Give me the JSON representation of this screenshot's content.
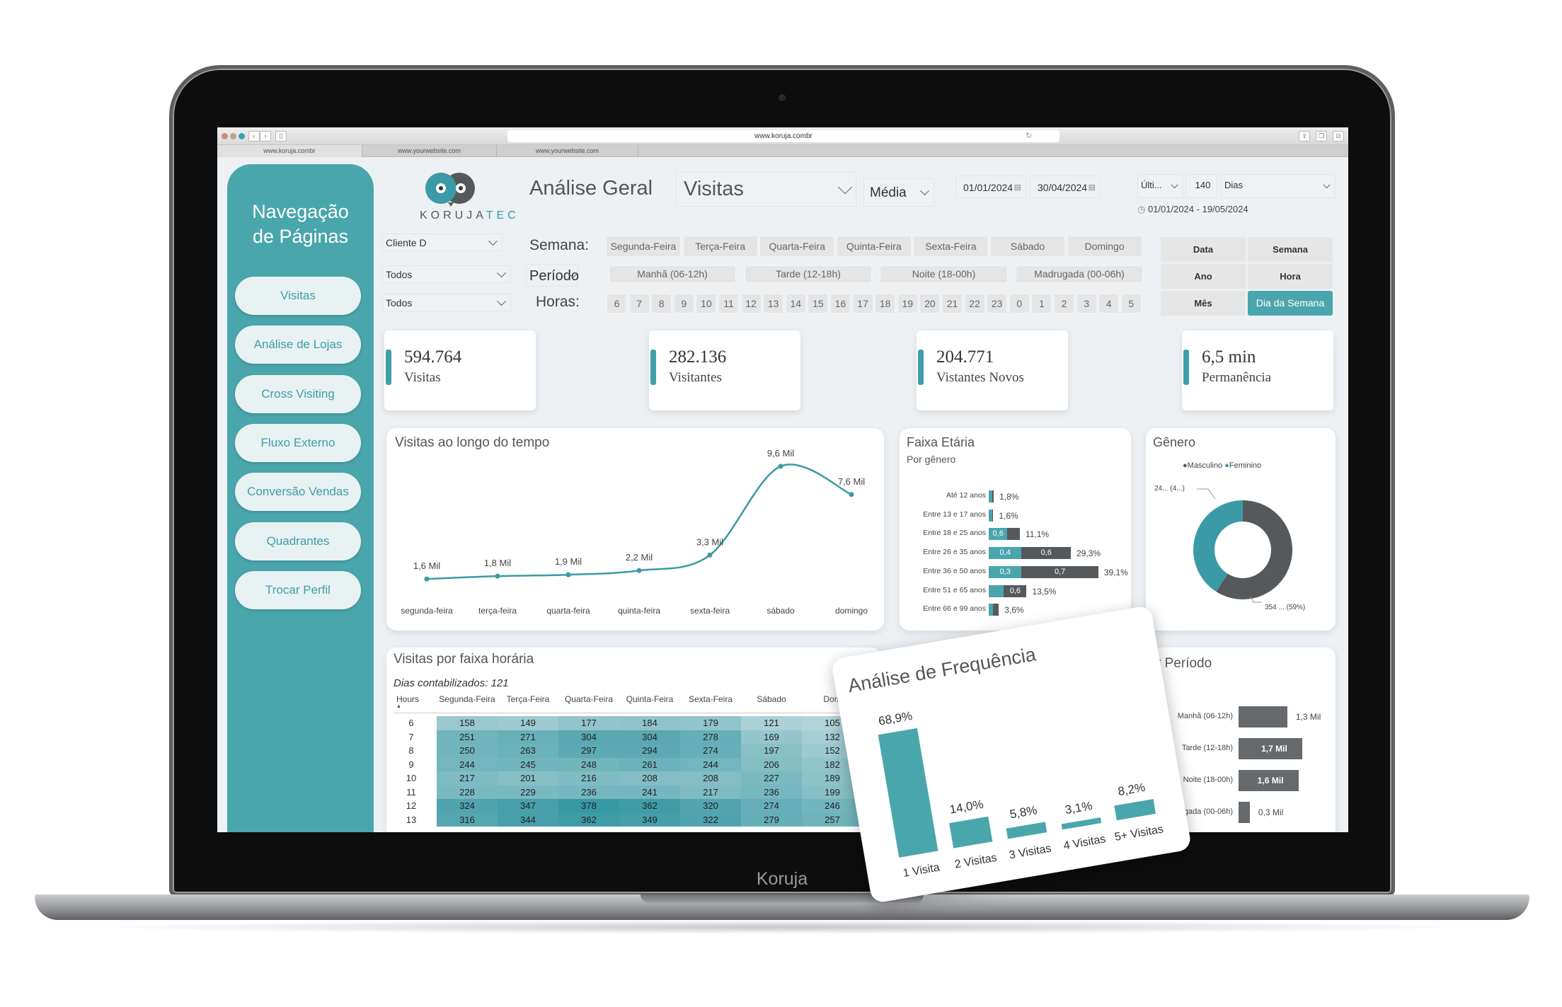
{
  "colors": {
    "teal": "#4aa6ad",
    "teal_dark": "#3a9aa5",
    "gray_dark": "#55595c",
    "dashboard_bg": "#edf1f4"
  },
  "laptop": {
    "brand": "Koruja"
  },
  "browser": {
    "url": "www.koruja.combr",
    "tabs": [
      "www.koruja.combr",
      "www.yourwebsite.com",
      "www.yourwebsite.com"
    ],
    "close": "x"
  },
  "sidebar": {
    "title_line1": "Navegação",
    "title_line2": "de Páginas",
    "items": [
      "Visitas",
      "Análise de Lojas",
      "Cross Visiting",
      "Fluxo Externo",
      "Conversão Vendas",
      "Quadrantes",
      "Trocar Perfil"
    ]
  },
  "logo": {
    "text_a": "KORUJA",
    "text_b": "TEC"
  },
  "filters": {
    "client": "Cliente D",
    "filter2": "Todos",
    "filter3": "Todos"
  },
  "header": {
    "title": "Análise Geral",
    "metric": "Visitas",
    "aggregation": "Média",
    "date_start": "01/01/2024",
    "date_end": "30/04/2024",
    "relative_mode": "Últi...",
    "relative_count": "140",
    "relative_unit": "Dias",
    "date_range": "01/01/2024 - 19/05/2024"
  },
  "semana": {
    "label": "Semana:",
    "days": [
      "Segunda-Feira",
      "Terça-Feira",
      "Quarta-Feira",
      "Quinta-Feira",
      "Sexta-Feira",
      "Sábado",
      "Domingo"
    ]
  },
  "periodo": {
    "label": "Período",
    "options": [
      "Manhã (06-12h)",
      "Tarde (12-18h)",
      "Noite (18-00h)",
      "Madrugada (00-06h)"
    ]
  },
  "horas": {
    "label": "Horas:",
    "values": [
      "6",
      "7",
      "8",
      "9",
      "10",
      "11",
      "12",
      "13",
      "14",
      "15",
      "16",
      "17",
      "18",
      "19",
      "20",
      "21",
      "22",
      "23",
      "0",
      "1",
      "2",
      "3",
      "4",
      "5"
    ]
  },
  "granularity": {
    "options": [
      "Data",
      "Semana",
      "Ano",
      "Hora",
      "Mês",
      "Dia da Semana"
    ],
    "active": "Dia da Semana"
  },
  "kpis": [
    {
      "value": "594.764",
      "label": "Visitas"
    },
    {
      "value": "282.136",
      "label": "Visitantes"
    },
    {
      "value": "204.771",
      "label": "Vistantes Novos"
    },
    {
      "value": "6,5 min",
      "label": "Permanência"
    }
  ],
  "chart_data": [
    {
      "type": "line",
      "title": "Visitas ao longo do tempo",
      "categories": [
        "segunda-feira",
        "terça-feira",
        "quarta-feira",
        "quinta-feira",
        "sexta-feira",
        "sábado",
        "domingo"
      ],
      "values": [
        1.6,
        1.8,
        1.9,
        2.2,
        3.3,
        9.6,
        7.6
      ],
      "data_labels": [
        "1,6 Mil",
        "1,8 Mil",
        "1,9 Mil",
        "2,2 Mil",
        "3,3 Mil",
        "9,6 Mil",
        "7,6 Mil"
      ],
      "unit": "Mil",
      "grid": false
    },
    {
      "type": "bar",
      "orientation": "horizontal",
      "stacked": true,
      "title": "Faixa Etária",
      "subtitle": "Por gênero",
      "categories": [
        "Até 12 anos",
        "Entre 13 e 17 anos",
        "Entre 18 e 25 anos",
        "Entre 26 e 35 anos",
        "Entre 36 e 50 anos",
        "Entre 51 e 65 anos",
        "Entre 66 e 99 anos"
      ],
      "totals": [
        1.8,
        1.6,
        11.1,
        29.3,
        39.1,
        13.5,
        3.6
      ],
      "total_labels": [
        "1,8%",
        "1,6%",
        "11,1%",
        "29,3%",
        "39,1%",
        "13,5%",
        "3,6%"
      ],
      "feminino_share": [
        0.7,
        0.8,
        0.6,
        0.4,
        0.3,
        0.4,
        0.4
      ],
      "feminino_labels": [
        "",
        "",
        "0,6",
        "0,4",
        "0,3",
        "",
        ""
      ],
      "masculino_labels": [
        "",
        "",
        "",
        "0,6",
        "0,7",
        "0,6",
        ""
      ]
    },
    {
      "type": "pie",
      "donut": true,
      "title": "Gênero",
      "legend": [
        "Masculino",
        "Feminino"
      ],
      "legend_position": "top",
      "values": [
        59,
        41
      ],
      "labels": [
        "354 ... (59%)",
        "24... (4...)"
      ]
    },
    {
      "type": "heatmap",
      "title": "Visitas por faixa horária",
      "subtitle": "Dias contabilizados: 121",
      "row_header": "Hours",
      "columns": [
        "Segunda-Feira",
        "Terça-Feira",
        "Quarta-Feira",
        "Quinta-Feira",
        "Sexta-Feira",
        "Sábado",
        "Dom"
      ],
      "rows": [
        "6",
        "7",
        "8",
        "9",
        "10",
        "11",
        "12",
        "13"
      ],
      "values": [
        [
          158,
          149,
          177,
          184,
          179,
          121,
          105
        ],
        [
          251,
          271,
          304,
          304,
          278,
          169,
          132
        ],
        [
          250,
          263,
          297,
          294,
          274,
          197,
          152
        ],
        [
          244,
          245,
          248,
          261,
          244,
          206,
          182
        ],
        [
          217,
          201,
          216,
          208,
          208,
          227,
          189
        ],
        [
          228,
          229,
          236,
          241,
          217,
          236,
          199
        ],
        [
          324,
          347,
          378,
          362,
          320,
          274,
          246
        ],
        [
          316,
          344,
          362,
          349,
          322,
          279,
          257
        ]
      ]
    },
    {
      "type": "bar",
      "orientation": "horizontal",
      "title": "Visitas por Período",
      "categories": [
        "Manhã (06-12h)",
        "Tarde (12-18h)",
        "Noite (18-00h)",
        "Madrugada (00-06h)"
      ],
      "values": [
        1.3,
        1.7,
        1.6,
        0.3
      ],
      "data_labels": [
        "1,3 Mil",
        "1,7 Mil",
        "1,6 Mil",
        "0,3 Mil"
      ],
      "unit": "Mil"
    },
    {
      "type": "bar",
      "title": "Análise de Frequência",
      "categories": [
        "1 Visita",
        "2 Visitas",
        "3 Visitas",
        "4 Visitas",
        "5+ Visitas"
      ],
      "values": [
        68.9,
        14.0,
        5.8,
        3.1,
        8.2
      ],
      "data_labels": [
        "68,9%",
        "14,0%",
        "5,8%",
        "3,1%",
        "8,2%"
      ]
    }
  ]
}
